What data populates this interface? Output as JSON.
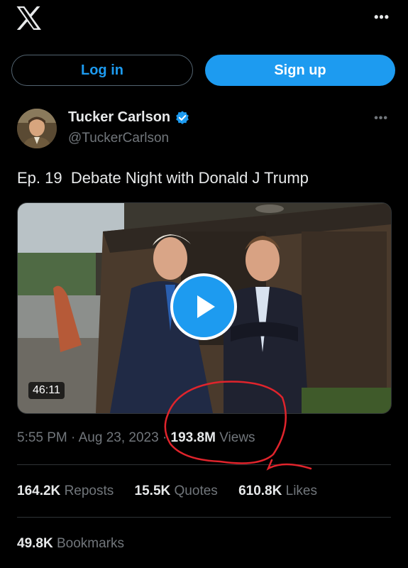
{
  "header": {
    "logo_icon": "x-logo-icon",
    "more_icon": "more-horizontal-icon"
  },
  "auth": {
    "login_label": "Log in",
    "signup_label": "Sign up"
  },
  "post": {
    "author_name": "Tucker Carlson",
    "author_handle": "@TuckerCarlson",
    "verified_icon": "verified-badge-icon",
    "text": "Ep. 19  Debate Night with Donald J Trump",
    "video_duration": "46:11",
    "time": "5:55 PM",
    "separator": "·",
    "date": "Aug 23, 2023",
    "views_count": "193.8M",
    "views_label": "Views"
  },
  "stats": {
    "reposts_count": "164.2K",
    "reposts_label": "Reposts",
    "quotes_count": "15.5K",
    "quotes_label": "Quotes",
    "likes_count": "610.8K",
    "likes_label": "Likes",
    "bookmarks_count": "49.8K",
    "bookmarks_label": "Bookmarks"
  },
  "colors": {
    "accent": "#1d9bf0",
    "background": "#000000",
    "muted": "#71767b",
    "annotation": "#e0242c"
  }
}
